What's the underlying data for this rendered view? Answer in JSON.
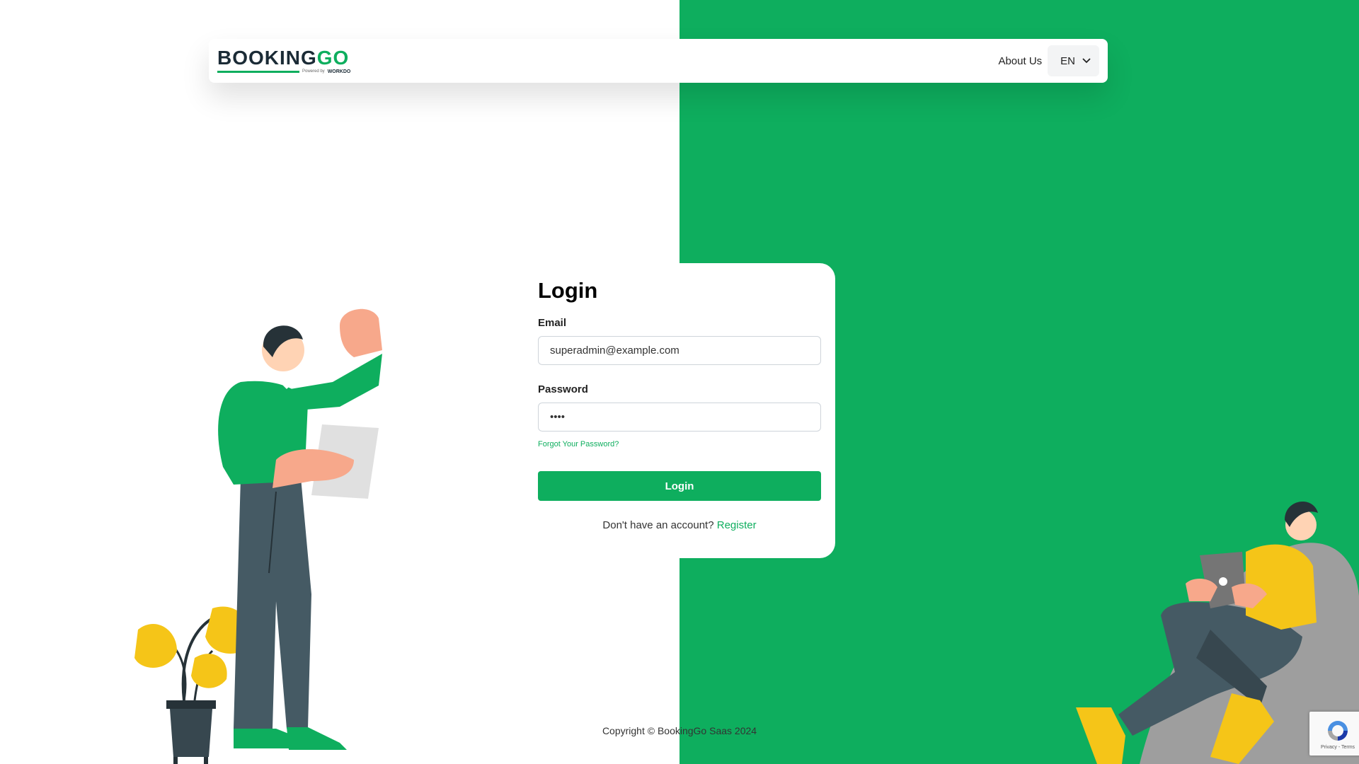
{
  "header": {
    "logo_main": "BOOKING",
    "logo_accent": "GO",
    "logo_powered": "Powered by",
    "logo_brand": "WORKDO",
    "about_label": "About Us",
    "language": "EN"
  },
  "login": {
    "title": "Login",
    "email_label": "Email",
    "email_value": "superadmin@example.com",
    "password_label": "Password",
    "password_value": "1234",
    "forgot_label": "Forgot Your Password?",
    "button_label": "Login",
    "no_account_text": "Don't have an account?",
    "register_label": "Register"
  },
  "footer": {
    "copyright": "Copyright © BookingGo Saas 2024"
  },
  "recaptcha": {
    "terms": "Privacy - Terms",
    "icon": "recaptcha-icon"
  },
  "colors": {
    "accent": "#0eae5e",
    "dark": "#1b2b36",
    "pants": "#455a64",
    "yellow": "#f5c518"
  }
}
